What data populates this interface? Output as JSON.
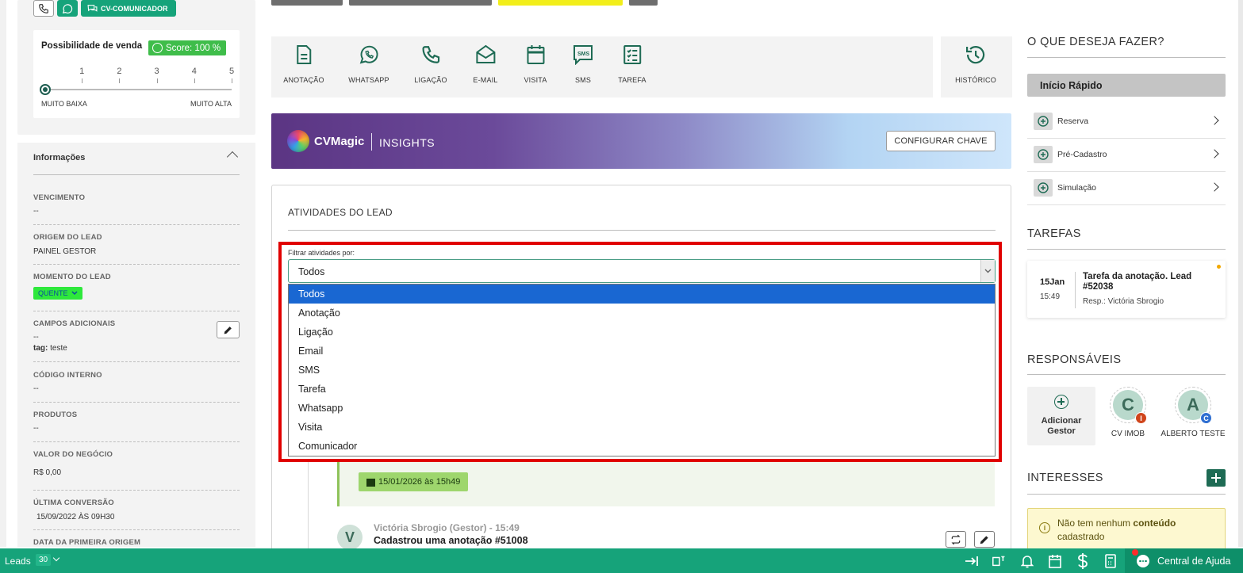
{
  "left": {
    "comunicador_label": "CV-COMUNICADOR",
    "score": {
      "title": "Possibilidade de venda",
      "badge": "Score: 100 %",
      "scale": [
        "1",
        "2",
        "3",
        "4",
        "5"
      ],
      "min_label": "MUITO BAIXA",
      "max_label": "MUITO ALTA",
      "level": 0
    },
    "info": {
      "title": "Informações",
      "vencimento_label": "VENCIMENTO",
      "vencimento_value": "--",
      "origem_label": "ORIGEM DO LEAD",
      "origem_value": "PAINEL GESTOR",
      "momento_label": "MOMENTO DO LEAD",
      "momento_value": "QUENTE",
      "campos_label": "CAMPOS ADICIONAIS",
      "campos_value": "--",
      "tag_key": "tag:",
      "tag_value": "teste",
      "codigo_label": "CÓDIGO INTERNO",
      "codigo_value": "--",
      "produtos_label": "PRODUTOS",
      "produtos_value": "--",
      "valor_label": "VALOR DO NEGÓCIO",
      "valor_value": "R$ 0,00",
      "ultima_label": "ÚLTIMA CONVERSÃO",
      "ultima_value": "15/09/2022 ÀS 09H30",
      "primeira_label": "DATA DA PRIMEIRA ORIGEM"
    }
  },
  "actions": {
    "items": [
      "ANOTAÇÃO",
      "WHATSAPP",
      "LIGAÇÃO",
      "E-MAIL",
      "VISITA",
      "SMS",
      "TAREFA"
    ],
    "historico": "HISTÓRICO"
  },
  "banner": {
    "brand": "CVMagic",
    "section": "INSIGHTS",
    "config_button": "CONFIGURAR CHAVE"
  },
  "activities": {
    "title": "ATIVIDADES DO LEAD",
    "filter_label": "Filtrar atividades por:",
    "filter_selected": "Todos",
    "filter_options": [
      "Todos",
      "Anotação",
      "Ligação",
      "Email",
      "SMS",
      "Tarefa",
      "Whatsapp",
      "Visita",
      "Comunicador"
    ],
    "task_date": "15/01/2026 às 15h49",
    "entry_avatar": "V",
    "entry_author": "Victória Sbrogio (Gestor) - 15:49",
    "entry_desc": "Cadastrou uma anotação #51008"
  },
  "right": {
    "what_title": "O QUE DESEJA FAZER?",
    "quick_start": "Início Rápido",
    "quick_items": [
      "Reserva",
      "Pré-Cadastro",
      "Simulação"
    ],
    "tarefas_title": "TAREFAS",
    "tarefa": {
      "day": "15Jan",
      "time": "15:49",
      "name": "Tarefa da anotação. Lead #52038",
      "resp": "Resp.: Victória Sbrogio"
    },
    "responsaveis_title": "RESPONSÁVEIS",
    "add_gestor": "Adicionar Gestor",
    "responsaveis": [
      {
        "initial": "C",
        "badge": "I",
        "badge_color": "#d0451b",
        "name": "CV IMOB"
      },
      {
        "initial": "A",
        "badge": "C",
        "badge_color": "#2f6fd1",
        "name": "ALBERTO TESTE"
      }
    ],
    "interesses_title": "INTERESSES",
    "notice_pre": "Não tem nenhum ",
    "notice_bold": "conteúdo",
    "notice_post": " cadastrado"
  },
  "bottom": {
    "leads_label": "Leads",
    "leads_count": "30",
    "help": "Central de Ajuda"
  },
  "colors": {
    "brand_green": "#16a37a",
    "highlight_red": "#e00000",
    "selected_option": "#1967d2"
  }
}
